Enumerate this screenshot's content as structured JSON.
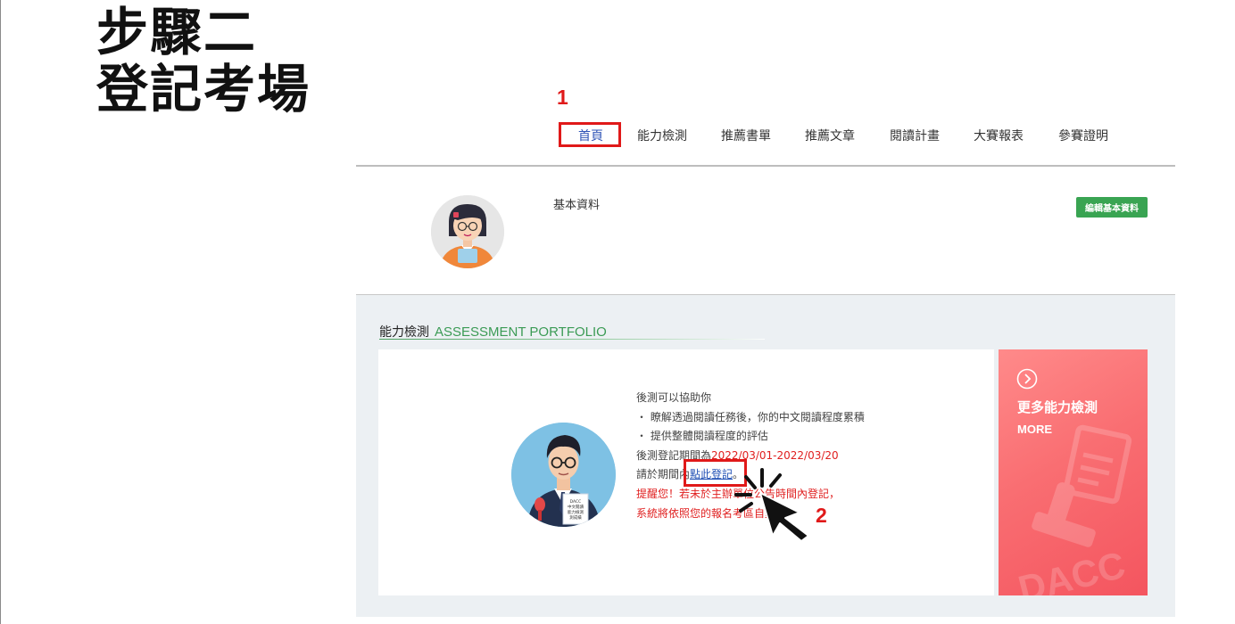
{
  "step": {
    "line1": "步驟二",
    "line2": "登記考場"
  },
  "annotations": {
    "one": "1",
    "two": "2"
  },
  "nav": {
    "items": [
      {
        "label": "首頁"
      },
      {
        "label": "能力檢測"
      },
      {
        "label": "推薦書單"
      },
      {
        "label": "推薦文章"
      },
      {
        "label": "閱讀計畫"
      },
      {
        "label": "大賽報表"
      },
      {
        "label": "參賽證明"
      }
    ]
  },
  "profile": {
    "label": "基本資料",
    "edit_button": "編輯基本資料"
  },
  "assessment": {
    "title_zh": "能力檢測",
    "title_en": "ASSESSMENT PORTFOLIO",
    "lines": {
      "intro": "後測可以協助你",
      "bullet1": "・ 瞭解透過閱讀任務後，你的中文閱讀程度累積",
      "bullet2": "・ 提供整體閱讀程度的評估",
      "period_prefix": "後測登記期間為",
      "period_value": "2022/03/01-2022/03/20",
      "register_prefix": "請於期間內",
      "register_link": "點此登記",
      "register_suffix": "。",
      "warning1": "提醒您！若未於主辦單位公告時間內登記，",
      "warning2": "系統將依照您的報名考區自動"
    },
    "book_text": [
      "DACC",
      "中文閱讀",
      "能力檢測",
      "測成績"
    ]
  },
  "more_card": {
    "title": "更多能力檢測",
    "sub": "MORE",
    "watermark": "DACC"
  },
  "colors": {
    "accent_blue": "#2f54b6",
    "green": "#39a452",
    "annotation_red": "#e01919",
    "pink": "#f96e72"
  }
}
